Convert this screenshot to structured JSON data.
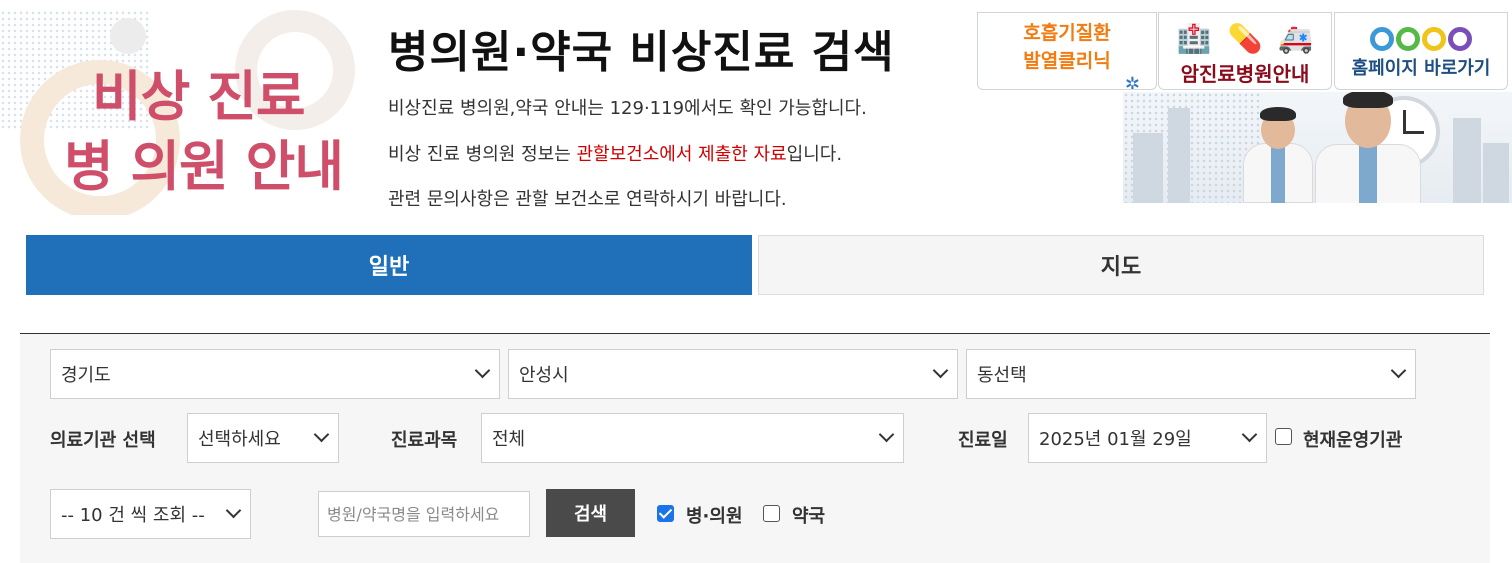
{
  "header": {
    "logo_line1": "비상 진료",
    "logo_line2": "병 의원 안내",
    "title": "병의원·약국 비상진료 검색",
    "notice1": "비상진료 병의원,약국 안내는 129·119에서도 확인 가능합니다.",
    "notice2_prefix": "비상 진료 병의원 정보는 ",
    "notice2_highlight": "관할보건소에서 제출한 자료",
    "notice2_suffix": "입니다.",
    "notice3": "관련 문의사항은 관할 보건소로 연락하시기 바랍니다."
  },
  "banners": {
    "fever_line1": "호흡기질환",
    "fever_line2": "발열클리닉",
    "cancer_label": "암진료병원안내",
    "homepage_label": "홈페이지 바로가기"
  },
  "tabs": [
    {
      "label": "일반",
      "active": true
    },
    {
      "label": "지도",
      "active": false
    }
  ],
  "filters": {
    "province": "경기도",
    "city": "안성시",
    "dong": "동선택",
    "institution_label": "의료기관 선택",
    "institution_value": "선택하세요",
    "department_label": "진료과목",
    "department_value": "전체",
    "date_label": "진료일",
    "date_value": "2025년 01월 29일",
    "open_now_label": "현재운영기관",
    "open_now_checked": false,
    "page_size": "-- 10 건 씩 조회 --",
    "search_placeholder": "병원/약국명을 입력하세요",
    "search_button": "검색",
    "hospital_label": "병·의원",
    "hospital_checked": true,
    "pharmacy_label": "약국",
    "pharmacy_checked": false
  },
  "colors": {
    "tab_active": "#1f6fb9",
    "logo_pink": "#cf4f6b",
    "highlight_red": "#d00000",
    "search_button": "#4a4a4a"
  }
}
